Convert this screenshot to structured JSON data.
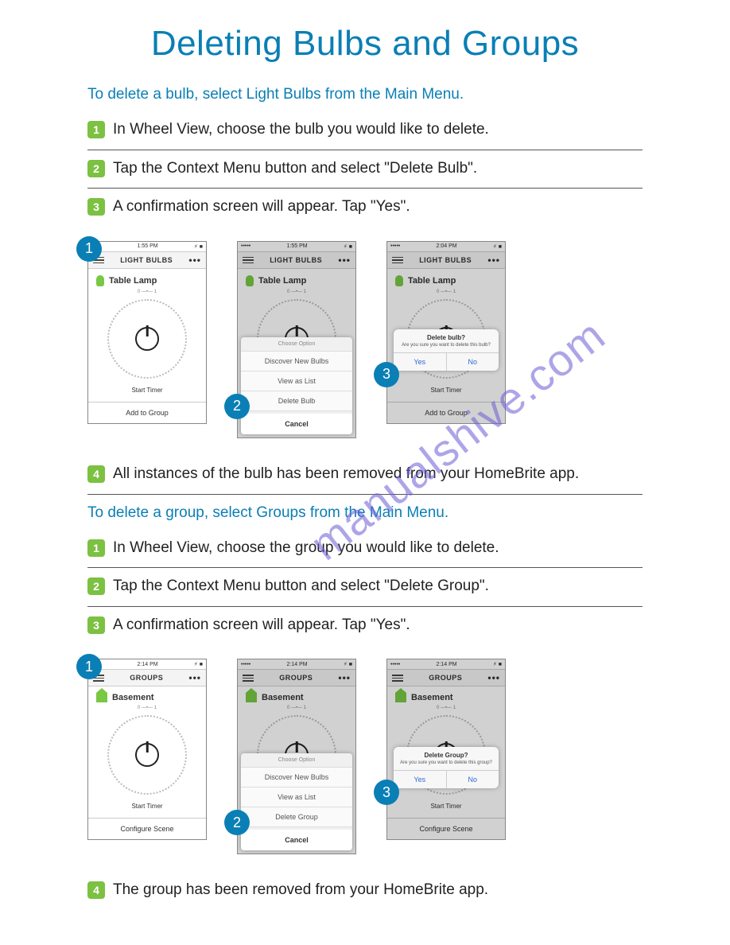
{
  "title": "Deleting Bulbs and Groups",
  "watermark": "manualshive.com",
  "bulb_section": {
    "intro": "To delete a bulb, select Light Bulbs from the Main Menu.",
    "steps": [
      "In Wheel View, choose the bulb you would like to delete.",
      "Tap the Context Menu button and select \"Delete Bulb\".",
      "A confirmation screen will appear. Tap \"Yes\".",
      "All instances of the bulb has been removed from your HomeBrite app."
    ],
    "screen": {
      "statusbar_time": "1:55 PM",
      "nav_title": "LIGHT BULBS",
      "item_name": "Table Lamp",
      "start_timer": "Start Timer",
      "bottom_btn": "Add to Group",
      "sheet_title": "Choose Option",
      "sheet_items": [
        "Discover New Bulbs",
        "View as List",
        "Delete Bulb"
      ],
      "sheet_cancel": "Cancel",
      "alert_title": "Delete bulb?",
      "alert_msg": "Are you sure you want to delete this bulb?",
      "alert_yes": "Yes",
      "alert_no": "No",
      "time3": "2:04 PM"
    }
  },
  "group_section": {
    "intro": "To delete a group, select Groups from the Main Menu.",
    "steps": [
      "In Wheel View, choose the group you would like to delete.",
      "Tap the Context Menu button and select \"Delete Group\".",
      "A confirmation screen will appear. Tap \"Yes\".",
      "The group has been removed from your HomeBrite app."
    ],
    "screen": {
      "statusbar_time": "2:14 PM",
      "nav_title": "GROUPS",
      "item_name": "Basement",
      "start_timer": "Start Timer",
      "bottom_btn": "Configure Scene",
      "sheet_title": "Choose Option",
      "sheet_items": [
        "Discover New Bulbs",
        "View as List",
        "Delete Group"
      ],
      "sheet_cancel": "Cancel",
      "alert_title": "Delete Group?",
      "alert_msg": "Are you sure you want to delete this group?",
      "alert_yes": "Yes",
      "alert_no": "No"
    }
  }
}
